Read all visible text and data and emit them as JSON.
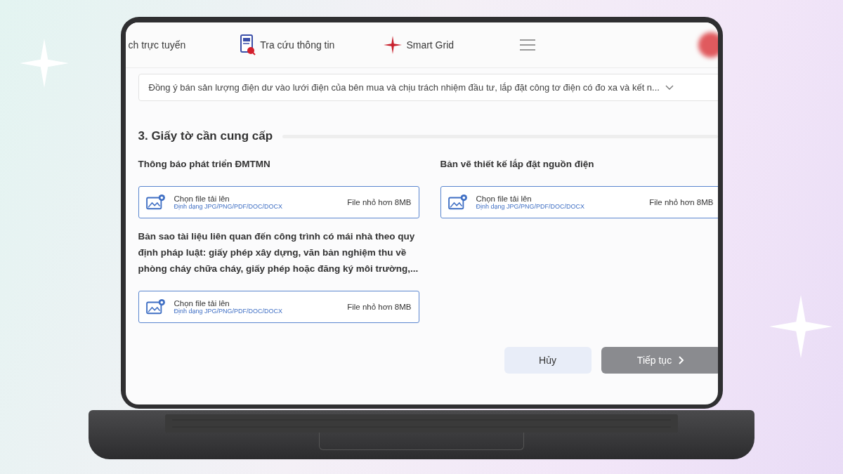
{
  "nav": {
    "items": [
      {
        "label": "ch trực tuyến",
        "kind": "plain"
      },
      {
        "label": "Tra cứu thông tin",
        "kind": "document"
      },
      {
        "label": "Smart Grid",
        "kind": "star"
      }
    ]
  },
  "agreement": {
    "value": "Đồng ý bán sản lượng điện dư vào lưới điện của bên mua và chịu trách nhiệm đầu tư, lắp đặt công tơ điện có đo xa và kết n..."
  },
  "section": {
    "title": "3. Giấy tờ cần cung cấp"
  },
  "columns": [
    [
      {
        "label": "Thông báo phát triển ĐMTMN",
        "upload": {
          "title": "Chọn file tải lên",
          "hint": "Định dạng JPG/PNG/PDF/DOC/DOCX",
          "size": "File nhỏ hơn 8MB"
        }
      },
      {
        "label": "Bản sao tài liệu liên quan đến công trình có mái nhà theo quy định pháp luật: giấy phép xây dựng, văn bản nghiệm thu về phòng cháy chữa cháy, giấy phép hoặc đăng ký môi trường,...",
        "upload": {
          "title": "Chọn file tải lên",
          "hint": "Định dạng JPG/PNG/PDF/DOC/DOCX",
          "size": "File nhỏ hơn 8MB"
        }
      }
    ],
    [
      {
        "label": "Bản vẽ thiết kế lắp đặt nguồn điện",
        "upload": {
          "title": "Chọn file tải lên",
          "hint": "Định dạng JPG/PNG/PDF/DOC/DOCX",
          "size": "File nhỏ hơn 8MB"
        }
      }
    ]
  ],
  "actions": {
    "cancel": "Hủy",
    "next": {
      "label": "Tiếp tục",
      "disabled": true
    }
  }
}
